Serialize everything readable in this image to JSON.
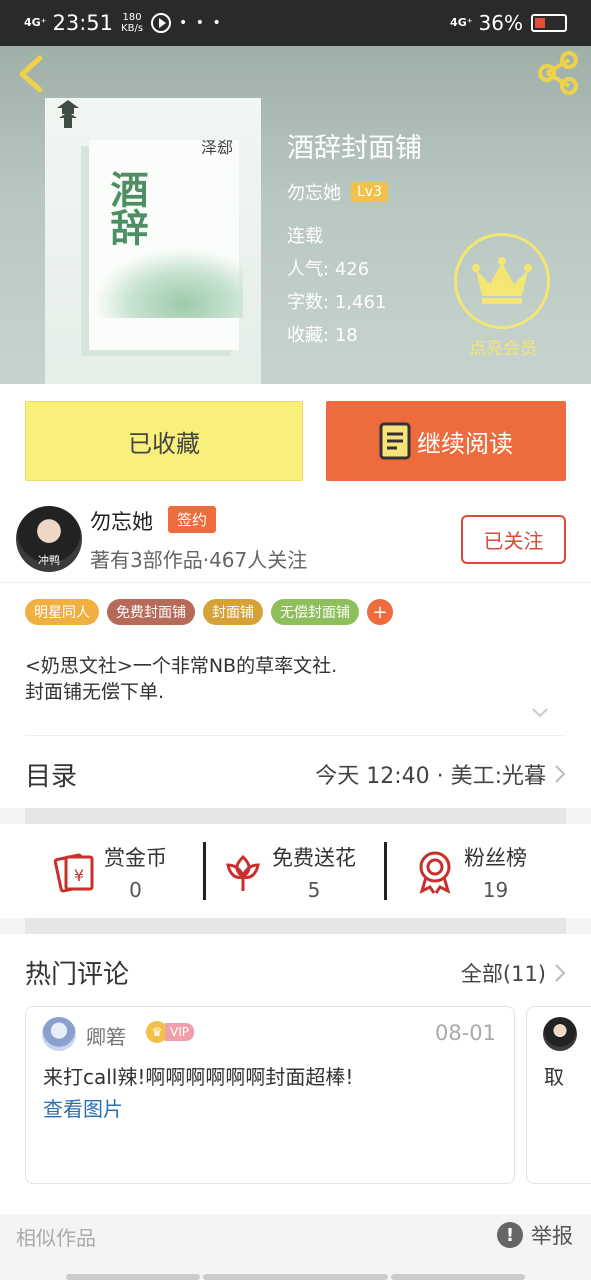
{
  "status_bar": {
    "network_left": "4G⁺",
    "time": "23:51",
    "speed_value": "180",
    "speed_unit": "KB/s",
    "dots": "• • •",
    "network_right": "4G⁺",
    "battery_percent": "36%"
  },
  "book": {
    "title": "酒辞封面铺",
    "author": "勿忘她",
    "level": "Lv3",
    "status": "连载",
    "popularity_label": "人气:",
    "popularity": "426",
    "word_count_label": "字数:",
    "word_count": "1,461",
    "favorites_label": "收藏:",
    "favorites": "18",
    "cover_calligraphy": "酒辞",
    "cover_stamp": "泽郄"
  },
  "vip": {
    "label": "点亮会员"
  },
  "actions": {
    "collected_label": "已收藏",
    "continue_label": "继续阅读"
  },
  "author_block": {
    "name": "勿忘她",
    "sign_badge": "签约",
    "stats": "著有3部作品·467人关注",
    "follow_label": "已关注",
    "avatar_tag": "冲鸭"
  },
  "tags": [
    {
      "label": "明星同人",
      "color": "#f0b040"
    },
    {
      "label": "免费封面铺",
      "color": "#b86a58"
    },
    {
      "label": "封面铺",
      "color": "#d6a235"
    },
    {
      "label": "无偿封面铺",
      "color": "#8fbf5a"
    }
  ],
  "tag_add": "+",
  "description": {
    "line1": "<奶思文社>一个非常NB的草率文社.",
    "line2": "封面铺无偿下单."
  },
  "toc": {
    "title": "目录",
    "info": "今天 12:40 · 美工:光暮"
  },
  "stats": [
    {
      "label": "赏金币",
      "value": "0"
    },
    {
      "label": "免费送花",
      "value": "5"
    },
    {
      "label": "粉丝榜",
      "value": "19"
    }
  ],
  "comments": {
    "title": "热门评论",
    "all_label": "全部(11)",
    "items": [
      {
        "user": "卿箬",
        "vip": "VIP",
        "date": "08-01",
        "text": "来打call辣!啊啊啊啊啊啊封面超棒!",
        "link": "查看图片"
      },
      {
        "text": "取"
      }
    ]
  },
  "footer": {
    "similar": "相似作品",
    "report": "举报",
    "report_icon": "!"
  },
  "colors": {
    "accent_orange": "#ed6b3d",
    "collected_yellow": "#f8f07a",
    "vip_yellow": "#f3e672",
    "follow_red": "#d94a3a",
    "link_blue": "#2b6fb6"
  }
}
